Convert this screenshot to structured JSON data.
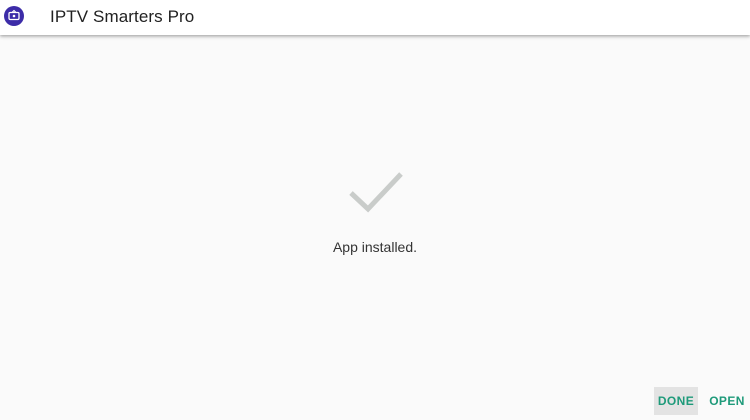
{
  "app_bar": {
    "title": "IPTV Smarters Pro",
    "icon": "tv-app-logo-icon"
  },
  "main": {
    "status_icon": "check-icon",
    "status_text": "App installed."
  },
  "actions": {
    "done_label": "DONE",
    "open_label": "OPEN"
  },
  "colors": {
    "accent": "#1e9a7a",
    "app_icon_bg": "#3c2ca8",
    "check": "#c9ccca",
    "background": "#fafafa"
  }
}
